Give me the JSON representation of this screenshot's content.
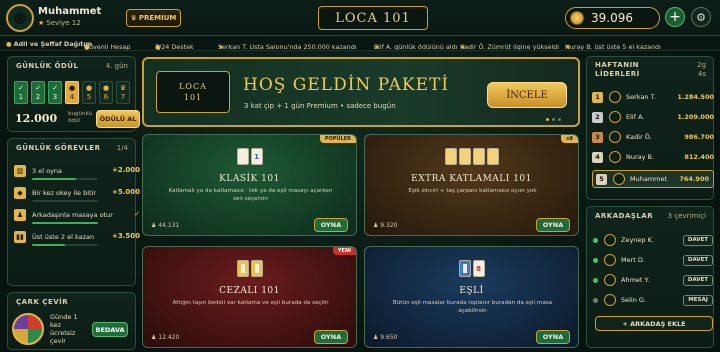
{
  "user": {
    "name": "Muhammet",
    "level": "Seviye 12",
    "premium_label": "PREMIUM"
  },
  "app": {
    "logo": "LOCA 101"
  },
  "wallet": {
    "coins": "39.096",
    "add_icon": "plus-icon",
    "settings_icon": "gear-icon"
  },
  "ticker": {
    "items": [
      "Adil ve Şeffaf Dağıtım",
      "Güvenli Hesap",
      "7/24 Destek"
    ],
    "news": [
      "Serkan T. Usta Salonu'nda 250.000 kazandı",
      "Elif A. günlük ödülünü aldı",
      "Kadir Ö. Zümrüt ligine yükseldi",
      "Nuray B. üst üste 5 el kazandı"
    ]
  },
  "daily": {
    "title": "GÜNLÜK ÖDÜL",
    "day_label": "4. gün",
    "days": [
      {
        "num": "1",
        "mark": "✓"
      },
      {
        "num": "2",
        "mark": "✓"
      },
      {
        "num": "3",
        "mark": "✓"
      },
      {
        "num": "4",
        "mark": "●"
      },
      {
        "num": "5",
        "mark": "●"
      },
      {
        "num": "6",
        "mark": "●"
      },
      {
        "num": "7",
        "mark": "♛"
      }
    ],
    "amount": "12.000",
    "amount_caption": "bugünkü ödül",
    "claim_label": "ÖDÜLÜ AL"
  },
  "tasks": {
    "title": "GÜNLÜK GÖREVLER",
    "count": "1/4",
    "items": [
      {
        "label": "3 el oyna",
        "reward": "+2.000",
        "progress": 0.66
      },
      {
        "label": "Bir kez okey ile bitir",
        "reward": "+5.000",
        "progress": 0.0
      },
      {
        "label": "Arkadaşınla masaya otur",
        "reward": "✓",
        "progress": 1.0
      },
      {
        "label": "Üst üste 2 el kazan",
        "reward": "+3.500",
        "progress": 0.5
      }
    ]
  },
  "wheel": {
    "title": "ÇARK ÇEVİR",
    "text": "Günde 1 kez ücretsiz çevir",
    "button": "BEDAVA"
  },
  "hero": {
    "logo_line1": "LOCA",
    "logo_line2": "101",
    "title": "HOŞ GELDİN PAKETİ",
    "subtitle": "3 kat çip + 1 gün Premium • sadece bugün",
    "button": "İNCELE"
  },
  "games": [
    {
      "title": "KLASİK 101",
      "desc": "Katlamalı ya da katlamasız · tek ya da eşli masayı açarken sen seçersin",
      "players": "44.131",
      "button": "OYNA",
      "badge": "POPÜLER",
      "tiles": [
        "",
        "1"
      ]
    },
    {
      "title": "EXTRA KATLAMALI 101",
      "desc": "Eşik zinciri + taş çarpanı katlamasız oyun yok",
      "players": "9.320",
      "button": "OYNA",
      "badge": "x8",
      "tiles": [
        "",
        "",
        "",
        ""
      ]
    },
    {
      "title": "CEZALI 101",
      "desc": "Attığın taşın bedeli var katlama ve eşli burada da seçilir",
      "players": "12.420",
      "button": "OYNA",
      "badge": "YENİ",
      "tiles": [
        "",
        ""
      ]
    },
    {
      "title": "EŞLİ",
      "desc": "Bütün eşli masalar burada toplanır buradan da eşli masa açabilirsin",
      "players": "9.650",
      "button": "OYNA",
      "badge": "",
      "tiles": [
        "",
        "8"
      ]
    }
  ],
  "leaderboard": {
    "title_line1": "HAFTANIN",
    "title_line2": "LİDERLERİ",
    "time_line1": "2g",
    "time_line2": "4s",
    "rows": [
      {
        "rank": "1",
        "name": "Serkan T.",
        "score": "1.284.500",
        "color": "#e2b54a"
      },
      {
        "rank": "2",
        "name": "Elif A.",
        "score": "1.209.000",
        "color": "#c8ccd0"
      },
      {
        "rank": "3",
        "name": "Kadir Ö.",
        "score": "986.700",
        "color": "#c98a4a"
      },
      {
        "rank": "4",
        "name": "Nuray B.",
        "score": "812.400",
        "color": "#d9d2bd"
      },
      {
        "rank": "5",
        "name": "Muhammet",
        "score": "764.900",
        "color": "#d9d2bd"
      }
    ]
  },
  "friends": {
    "title": "ARKADAŞLAR",
    "online": "3 çevrimiçi",
    "rows": [
      {
        "name": "Zeynep K.",
        "action": "DAVET",
        "online": true
      },
      {
        "name": "Mert D.",
        "action": "DAVET",
        "online": true
      },
      {
        "name": "Ahmet Y.",
        "action": "DAVET",
        "online": true
      },
      {
        "name": "Selin G.",
        "action": "MESAJ",
        "online": false
      }
    ],
    "add_label": "+ ARKADAŞ EKLE"
  }
}
